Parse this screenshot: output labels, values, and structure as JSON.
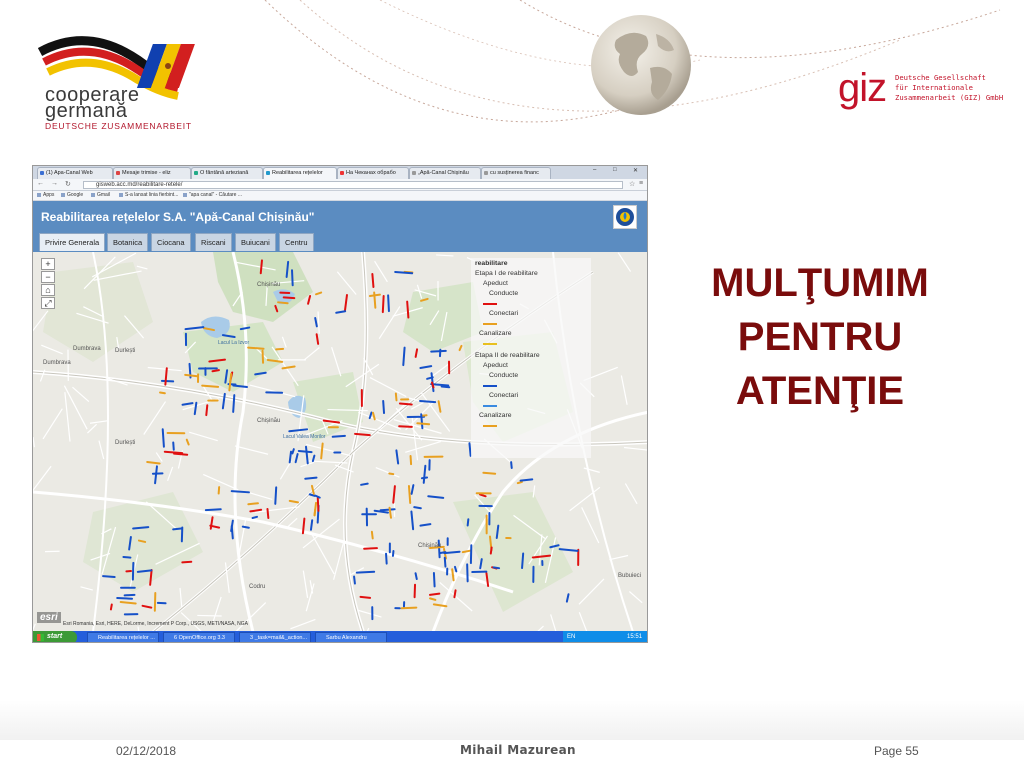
{
  "logos": {
    "cooperare_line1": "cooperare",
    "cooperare_line2": "germană",
    "cooperare_line3": "DEUTSCHE ZUSAMMENARBEIT",
    "giz": "giz",
    "giz_sub": "Deutsche Gesellschaft\nfür Internationale\nZusammenarbeit (GIZ) GmbH"
  },
  "browser": {
    "tabs": [
      {
        "label": "(1) Apa-Canal Web"
      },
      {
        "label": "Mesaje trimise - eliz"
      },
      {
        "label": "O fântână arteziană"
      },
      {
        "label": "Reabilitarea rețelelor"
      },
      {
        "label": "На Чеканах обрабо"
      },
      {
        "label": "„Apă-Canal Chișinău"
      },
      {
        "label": "cu susținerea financ"
      }
    ],
    "url": "gisweb.acc.md/reabilitare-retele/",
    "bookmarks": [
      "Apps",
      "Google",
      "Gmail",
      "S-a lansat linia fierbint...",
      "\"apa canal\" - Căutare ..."
    ]
  },
  "app": {
    "title": "Reabilitarea rețelelor S.A. \"Apă-Canal Chișinău\"",
    "tabs": [
      "Privire Generala",
      "Botanica",
      "Ciocana",
      "Riscani",
      "Buiucani",
      "Centru"
    ],
    "active_tab": "Privire Generala",
    "zoom_in": "+",
    "zoom_out": "−"
  },
  "map": {
    "legend": {
      "title": "reabilitare",
      "stage1": "Etapa I de reabilitare",
      "stage2": "Etapa II de reabilitare",
      "apeduct": "Apeduct",
      "conducte": "Conducte",
      "conectari": "Conectari",
      "canalizare": "Canalizare"
    },
    "labels": [
      "Chișinău",
      "Chișinău",
      "Chișinău",
      "Durlești",
      "Durlești",
      "Dumbrava",
      "Dumbrava",
      "Codru",
      "Bubuieci",
      "Lacul Valea Morilor",
      "Lacul La Izvor"
    ],
    "attribution": "Esri Romania, Esri, HERE, DeLorme, Increment P Corp., USGS, METI/NASA, NGA",
    "esri": "esri",
    "colors": {
      "stage1": "#e01010",
      "stage2": "#1550c8",
      "canal": "#e8a020"
    }
  },
  "taskbar": {
    "start": "start",
    "items": [
      "Reabilitarea rețelelor ...",
      "6 OpenOffice.org 3.3",
      "3 _task=mail&_action...",
      "Sarbu Alexandru"
    ],
    "lang": "EN",
    "time": "15:51"
  },
  "slide": {
    "thanks_line1": "MULŢUMIM",
    "thanks_line2": "PENTRU",
    "thanks_line3": "ATENŢIE",
    "date": "02/12/2018",
    "author": "Mihail Mazurean",
    "page": "Page 55"
  }
}
